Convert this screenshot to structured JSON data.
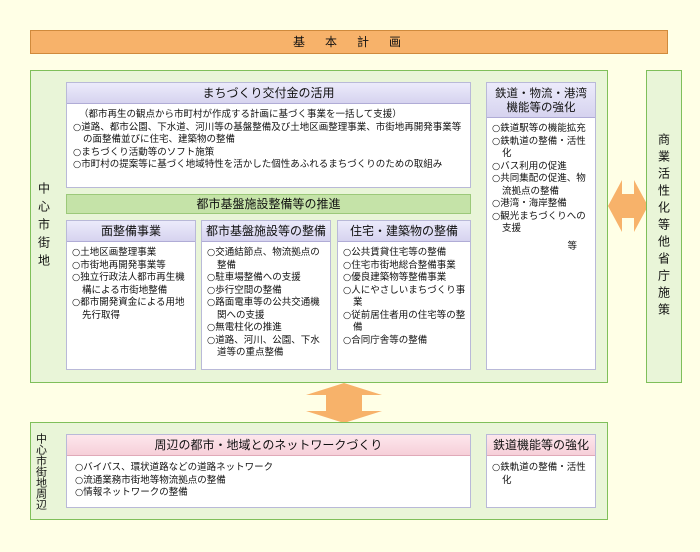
{
  "title": "基　本　計　画",
  "central_area": {
    "label": "中心市街地",
    "grant": {
      "heading": "まちづくり交付金の活用",
      "note": "（都市再生の観点から市町村が作成する計画に基づく事業を一括して支援）",
      "items": [
        "○道路、都市公園、下水道、河川等の基盤整備及び土地区画整理事業、市街地再開発事業等の面整備並びに住宅、建築物の整備",
        "○まちづくり活動等のソフト施策",
        "○市町村の提案等に基づく地域特性を活かした個性あふれるまちづくりのための取組み"
      ]
    },
    "infrastructure_banner": "都市基盤施設整備等の推進",
    "columns": [
      {
        "heading": "面整備事業",
        "items": [
          "○土地区画整理事業",
          "○市街地再開発事業等",
          "○独立行政法人都市再生機構による市街地整備",
          "○都市開発資金による用地先行取得"
        ]
      },
      {
        "heading": "都市基盤施設等の整備",
        "items": [
          "○交通結節点、物流拠点の整備",
          "○駐車場整備への支援",
          "○歩行空間の整備",
          "○路面電車等の公共交通機関への支援",
          "○無電柱化の推進",
          "○道路、河川、公園、下水道等の重点整備"
        ]
      },
      {
        "heading": "住宅・建築物の整備",
        "items": [
          "○公共賃貸住宅等の整備",
          "○住宅市街地総合整備事業",
          "○優良建築物等整備事業",
          "○人にやさしいまちづくり事業",
          "○従前居住者用の住宅等の整備",
          "○合同庁舎等の整備"
        ]
      }
    ],
    "rail": {
      "heading": "鉄道・物流・港湾機能等の強化",
      "items": [
        "○鉄道駅等の機能拡充",
        "○鉄軌道の整備・活性化",
        "○バス利用の促進",
        "○共同集配の促進、物流拠点の整備",
        "○港湾・海岸整備",
        "○観光まちづくりへの支援"
      ],
      "suffix": "等"
    }
  },
  "side_label": "商業活性化等他省庁施策",
  "periphery": {
    "label": "中心市街地周辺",
    "network": {
      "heading": "周辺の都市・地域とのネットワークづくり",
      "items": [
        "○バイパス、環状道路などの道路ネットワーク",
        "○流通業務市街地等物流拠点の整備",
        "○情報ネットワークの整備"
      ]
    },
    "rail": {
      "heading": "鉄道機能等の強化",
      "items": [
        "○鉄軌道の整備・活性化"
      ]
    }
  },
  "colors": {
    "title_bar": "#f7b26a",
    "frame": "#7fbf5a",
    "banner": "#c5e3a8",
    "arrow": "#f7b26a"
  }
}
